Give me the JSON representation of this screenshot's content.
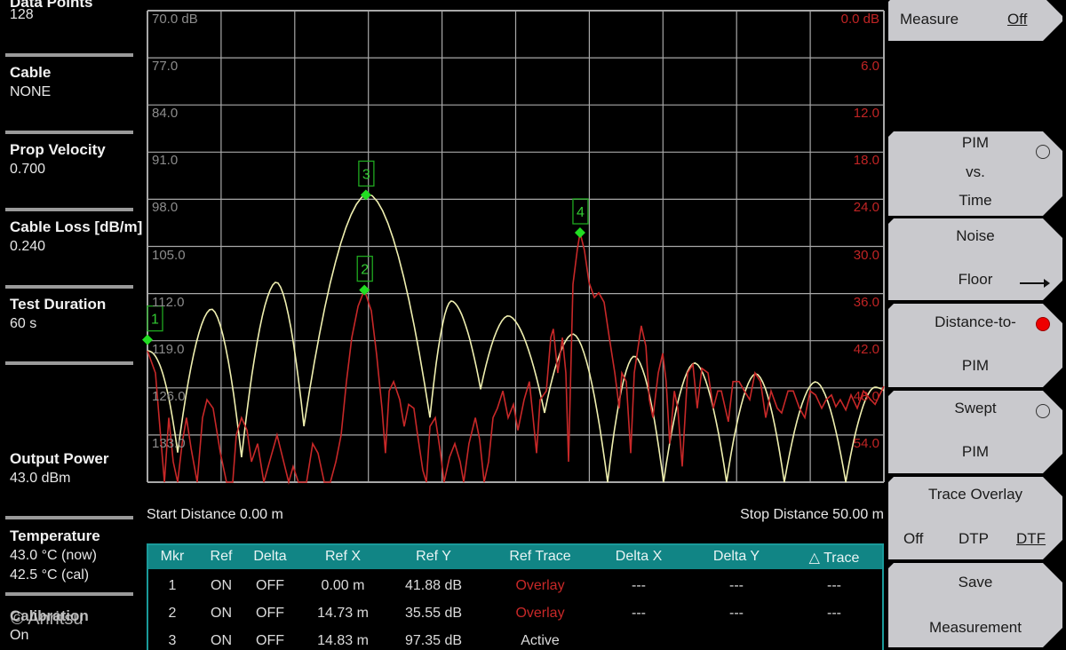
{
  "left_panel": {
    "data_points": {
      "label": "Data Points",
      "value": "128"
    },
    "cable": {
      "label": "Cable",
      "value": "NONE"
    },
    "prop_velocity": {
      "label": "Prop Velocity",
      "value": "0.700"
    },
    "cable_loss": {
      "label": "Cable Loss [dB/m]",
      "value": "0.240"
    },
    "test_duration": {
      "label": "Test Duration",
      "value": "60 s"
    },
    "output_power": {
      "label": "Output Power",
      "value": "43.0 dBm"
    },
    "temperature": {
      "label": "Temperature",
      "now": "43.0 °C  (now)",
      "cal": "42.5 °C  (cal)"
    },
    "calibration": {
      "label": "Calibration",
      "value": "On"
    },
    "watermark": "© Anritsu"
  },
  "chart_data": {
    "type": "line",
    "x_range": [
      0,
      50
    ],
    "x_unit": "m",
    "left_axis": {
      "range": [
        70,
        140
      ],
      "ticks": [
        "70.0 dB",
        "77.0",
        "84.0",
        "91.0",
        "98.0",
        "105.0",
        "112.0",
        "119.0",
        "126.0",
        "133.0"
      ]
    },
    "right_axis": {
      "range": [
        0,
        60
      ],
      "ticks": [
        "0.0 dB",
        "6.0",
        "12.0",
        "18.0",
        "24.0",
        "30.0",
        "36.0",
        "42.0",
        "48.0",
        "54.0"
      ]
    },
    "grid": true,
    "start_label": "Start Distance 0.00 m",
    "stop_label": "Stop Distance 50.00 m",
    "series": [
      {
        "name": "Active",
        "axis": "left",
        "color": "#f0f0b0",
        "lobes": [
          {
            "start": 0,
            "peak": 0,
            "end": 2.05,
            "start_db": 120.5,
            "peak_db": 120.5,
            "end_db": 135.6
          },
          {
            "start": 2.05,
            "peak": 4.34,
            "end": 6.39,
            "start_db": 135.6,
            "peak_db": 114.3,
            "end_db": 136.3
          },
          {
            "start": 6.39,
            "peak": 8.75,
            "end": 10.62,
            "start_db": 136.3,
            "peak_db": 110.3,
            "end_db": 131.7
          },
          {
            "start": 10.62,
            "peak": 14.96,
            "end": 19.18,
            "start_db": 131.7,
            "peak_db": 97.2,
            "end_db": 130.4
          },
          {
            "start": 19.18,
            "peak": 20.63,
            "end": 22.62,
            "start_db": 130.4,
            "peak_db": 113.1,
            "end_db": 126.2
          },
          {
            "start": 22.62,
            "peak": 24.49,
            "end": 26.96,
            "start_db": 126.2,
            "peak_db": 115.3,
            "end_db": 129.7
          },
          {
            "start": 26.96,
            "peak": 28.89,
            "end": 31.24,
            "start_db": 129.7,
            "peak_db": 118.0,
            "end_db": 140
          },
          {
            "start": 31.24,
            "peak": 33.05,
            "end": 35.04,
            "start_db": 140,
            "peak_db": 121.3,
            "end_db": 140
          },
          {
            "start": 35.04,
            "peak": 37.15,
            "end": 39.32,
            "start_db": 140,
            "peak_db": 122.3,
            "end_db": 140
          },
          {
            "start": 39.32,
            "peak": 41.31,
            "end": 43.24,
            "start_db": 140,
            "peak_db": 123.9,
            "end_db": 140
          },
          {
            "start": 43.24,
            "peak": 45.36,
            "end": 47.41,
            "start_db": 140,
            "peak_db": 125.1,
            "end_db": 140
          },
          {
            "start": 47.41,
            "peak": 49.4,
            "end": 50,
            "start_db": 140,
            "peak_db": 125.9,
            "end_db": 126.4
          }
        ]
      },
      {
        "name": "Overlay",
        "axis": "right",
        "color": "#c82828",
        "points": [
          [
            0,
            43.3
          ],
          [
            0.54,
            46.1
          ],
          [
            0.84,
            52.9
          ],
          [
            1.15,
            60
          ],
          [
            1.45,
            51.8
          ],
          [
            1.75,
            57.4
          ],
          [
            2.05,
            60
          ],
          [
            2.35,
            55.1
          ],
          [
            2.65,
            51.8
          ],
          [
            2.96,
            55.7
          ],
          [
            3.38,
            60
          ],
          [
            3.74,
            51.8
          ],
          [
            4.04,
            49.5
          ],
          [
            4.46,
            50.6
          ],
          [
            4.95,
            56.3
          ],
          [
            5.37,
            60
          ],
          [
            5.79,
            60
          ],
          [
            6.03,
            54.0
          ],
          [
            6.39,
            51.8
          ],
          [
            6.76,
            53.4
          ],
          [
            7.06,
            57.4
          ],
          [
            7.48,
            55.1
          ],
          [
            7.9,
            60
          ],
          [
            8.38,
            56.8
          ],
          [
            8.8,
            54.0
          ],
          [
            9.17,
            56.8
          ],
          [
            9.59,
            60
          ],
          [
            9.89,
            58.0
          ],
          [
            10.25,
            60
          ],
          [
            10.8,
            60
          ],
          [
            11.22,
            55.1
          ],
          [
            11.58,
            56.3
          ],
          [
            12.0,
            60
          ],
          [
            12.42,
            60
          ],
          [
            12.79,
            57.4
          ],
          [
            13.15,
            54.0
          ],
          [
            13.51,
            47.2
          ],
          [
            13.87,
            41.6
          ],
          [
            14.3,
            37.6
          ],
          [
            14.73,
            35.55
          ],
          [
            15.2,
            38.2
          ],
          [
            15.56,
            43.8
          ],
          [
            15.92,
            50.6
          ],
          [
            16.16,
            56.3
          ],
          [
            16.41,
            48.4
          ],
          [
            16.71,
            47.2
          ],
          [
            17.13,
            49.5
          ],
          [
            17.43,
            52.9
          ],
          [
            17.73,
            50.1
          ],
          [
            18.09,
            50.6
          ],
          [
            18.34,
            54.0
          ],
          [
            18.7,
            58.5
          ],
          [
            18.94,
            60
          ],
          [
            19.18,
            52.9
          ],
          [
            19.54,
            51.8
          ],
          [
            19.9,
            56.3
          ],
          [
            20.14,
            60
          ],
          [
            20.51,
            56.8
          ],
          [
            20.87,
            55.1
          ],
          [
            21.23,
            57.4
          ],
          [
            21.47,
            60
          ],
          [
            21.83,
            55.1
          ],
          [
            22.26,
            51.8
          ],
          [
            22.56,
            54.6
          ],
          [
            22.86,
            60
          ],
          [
            23.16,
            57.4
          ],
          [
            23.46,
            51.8
          ],
          [
            23.76,
            50.6
          ],
          [
            24.13,
            48.4
          ],
          [
            24.49,
            51.8
          ],
          [
            24.85,
            50.1
          ],
          [
            25.15,
            53.4
          ],
          [
            25.57,
            49.5
          ],
          [
            25.93,
            47.2
          ],
          [
            26.18,
            51.8
          ],
          [
            26.42,
            56.3
          ],
          [
            26.66,
            49.5
          ],
          [
            27.08,
            48.4
          ],
          [
            27.38,
            41.6
          ],
          [
            27.56,
            40.5
          ],
          [
            27.86,
            46.1
          ],
          [
            28.17,
            41.6
          ],
          [
            28.41,
            46.1
          ],
          [
            28.59,
            57.4
          ],
          [
            28.89,
            34.8
          ],
          [
            29.19,
            30.3
          ],
          [
            29.37,
            28.25
          ],
          [
            29.67,
            30.5
          ],
          [
            29.98,
            34.6
          ],
          [
            30.34,
            36.5
          ],
          [
            30.64,
            35.9
          ],
          [
            31.0,
            37.1
          ],
          [
            31.36,
            41.6
          ],
          [
            31.73,
            46.1
          ],
          [
            32.03,
            50.6
          ],
          [
            32.21,
            46.1
          ],
          [
            32.51,
            47.2
          ],
          [
            32.81,
            56.3
          ],
          [
            33.05,
            46.1
          ],
          [
            33.53,
            40.1
          ],
          [
            33.84,
            42.7
          ],
          [
            34.08,
            49.5
          ],
          [
            34.32,
            51.8
          ],
          [
            34.68,
            46.1
          ],
          [
            34.98,
            43.6
          ],
          [
            35.22,
            47.2
          ],
          [
            35.46,
            55.1
          ],
          [
            35.77,
            48.4
          ],
          [
            36.01,
            50.6
          ],
          [
            36.31,
            58.0
          ],
          [
            36.67,
            46.1
          ],
          [
            37.03,
            45.0
          ],
          [
            37.33,
            50.6
          ],
          [
            37.64,
            45.5
          ],
          [
            38.06,
            46.1
          ],
          [
            38.42,
            50.6
          ],
          [
            38.72,
            48.4
          ],
          [
            38.96,
            48.4
          ],
          [
            39.44,
            52.3
          ],
          [
            39.75,
            47.2
          ],
          [
            40.17,
            47.2
          ],
          [
            40.53,
            48.4
          ],
          [
            40.89,
            49.5
          ],
          [
            41.25,
            46.1
          ],
          [
            41.62,
            47.2
          ],
          [
            41.98,
            51.8
          ],
          [
            42.34,
            48.4
          ],
          [
            42.76,
            50.6
          ],
          [
            43.06,
            51.2
          ],
          [
            43.49,
            48.4
          ],
          [
            43.85,
            48.4
          ],
          [
            44.27,
            50.6
          ],
          [
            44.63,
            51.8
          ],
          [
            44.99,
            48.4
          ],
          [
            45.36,
            48.9
          ],
          [
            45.78,
            50.6
          ],
          [
            46.08,
            49.5
          ],
          [
            46.44,
            48.9
          ],
          [
            46.74,
            50.4
          ],
          [
            47.04,
            49.5
          ],
          [
            47.41,
            50.8
          ],
          [
            47.77,
            48.9
          ],
          [
            48.19,
            50.6
          ],
          [
            48.61,
            48.4
          ],
          [
            49.1,
            49.5
          ],
          [
            49.4,
            50.1
          ],
          [
            50,
            47.8
          ]
        ]
      }
    ],
    "markers": [
      {
        "id": "1",
        "x": 0.0,
        "axis": "right",
        "y": 41.88
      },
      {
        "id": "2",
        "x": 14.73,
        "axis": "right",
        "y": 35.55
      },
      {
        "id": "3",
        "x": 14.83,
        "axis": "left",
        "y": 97.35
      },
      {
        "id": "4",
        "x": 29.37,
        "axis": "right",
        "y": 28.25
      }
    ],
    "marker_color": "#22dd22"
  },
  "marker_table": {
    "headers": [
      "Mkr",
      "Ref",
      "Delta",
      "Ref X",
      "Ref Y",
      "Ref Trace",
      "Delta X",
      "Delta Y",
      "△ Trace"
    ],
    "rows": [
      [
        "1",
        "ON",
        "OFF",
        "0.00 m",
        "41.88 dB",
        "Overlay",
        "---",
        "---",
        "---"
      ],
      [
        "2",
        "ON",
        "OFF",
        "14.73 m",
        "35.55 dB",
        "Overlay",
        "---",
        "---",
        "---"
      ],
      [
        "3",
        "ON",
        "OFF",
        "14.83 m",
        "97.35 dB",
        "Active",
        "",
        "",
        ""
      ]
    ],
    "overlay_color": "#c82828"
  },
  "softkeys": {
    "measure": {
      "label": "Measure",
      "value": "Off"
    },
    "pim_vs_time": {
      "l1": "PIM",
      "l2": "vs.",
      "l3": "Time"
    },
    "noise_floor": {
      "l1": "Noise",
      "l2": "Floor"
    },
    "distance_to_pim": {
      "l1": "Distance-to-",
      "l2": "PIM"
    },
    "swept_pim": {
      "l1": "Swept",
      "l2": "PIM"
    },
    "trace_overlay": {
      "label": "Trace Overlay",
      "opt1": "Off",
      "opt2": "DTP",
      "opt3": "DTF"
    },
    "save_measurement": {
      "l1": "Save",
      "l2": "Measurement"
    }
  }
}
